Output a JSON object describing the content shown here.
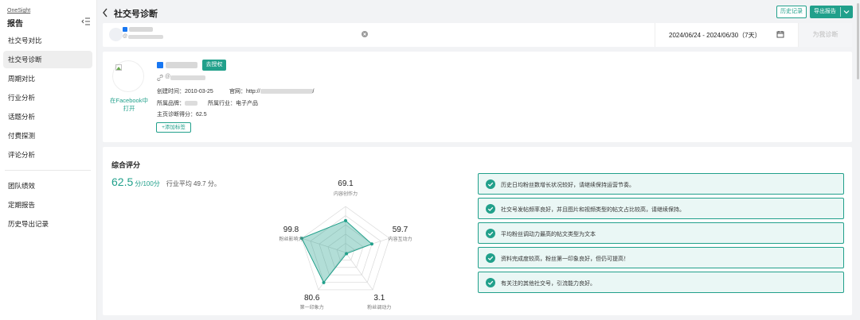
{
  "sidebar": {
    "brand": "OneSight",
    "title": "报告",
    "items": [
      {
        "label": "社交号对比",
        "active": false
      },
      {
        "label": "社交号诊断",
        "active": true
      },
      {
        "label": "周期对比",
        "active": false
      },
      {
        "label": "行业分析",
        "active": false
      },
      {
        "label": "话题分析",
        "active": false
      },
      {
        "label": "付费探测",
        "active": false
      },
      {
        "label": "评论分析",
        "active": false
      }
    ],
    "items2": [
      {
        "label": "团队绩效"
      },
      {
        "label": "定期报告"
      },
      {
        "label": "历史导出记录"
      }
    ]
  },
  "header": {
    "title": "社交号诊断",
    "history_label": "历史记录",
    "export_label": "导出报告"
  },
  "search": {
    "account_at": "@",
    "date_range": "2024/06/24 - 2024/06/30（7天）",
    "diagnose_label": "为我诊断"
  },
  "profile": {
    "open_fb": "在Facebook中打开",
    "auth_label": "去授权",
    "at": "@",
    "created_label": "创建时间：",
    "created_value": "2010-03-25",
    "site_label": "官网：",
    "site_prefix": "http://",
    "site_suffix": "/",
    "brand_label": "所属品牌：",
    "industry_label": "所属行业：",
    "industry_value": "电子产品",
    "score_label": "主页诊断得分：",
    "score_value": "62.5",
    "add_tag_label": "+添加标签"
  },
  "score": {
    "title": "综合评分",
    "value": "62.5",
    "unit": "分/100分",
    "industry_avg": "行业平均 49.7 分。"
  },
  "chart_data": {
    "type": "radar",
    "max": 100,
    "axes": [
      {
        "label": "内容创作力",
        "value": 69.1
      },
      {
        "label": "内容互动力",
        "value": 59.7
      },
      {
        "label": "粉丝调动力",
        "value": 3.1
      },
      {
        "label": "第一印象力",
        "value": 80.6
      },
      {
        "label": "粉丝影响力",
        "value": 99.8
      }
    ],
    "colors": {
      "fill": "#21a08b",
      "grid": "#d9d9d9"
    }
  },
  "tips": [
    "历史日均粉丝数增长状况较好，请继续保持运营节奏。",
    "社交号发帖频率良好，并且图片和视频类型的帖文占比较高，请继续保持。",
    "平均粉丝调动力最高的帖文类型为文本",
    "资料完成度较高，粉丝第一印象良好，但仍可提高！",
    "有关注的其他社交号，引流能力良好。"
  ],
  "colors": {
    "accent": "#21a08b",
    "tip_bg": "#eaf7f5"
  }
}
